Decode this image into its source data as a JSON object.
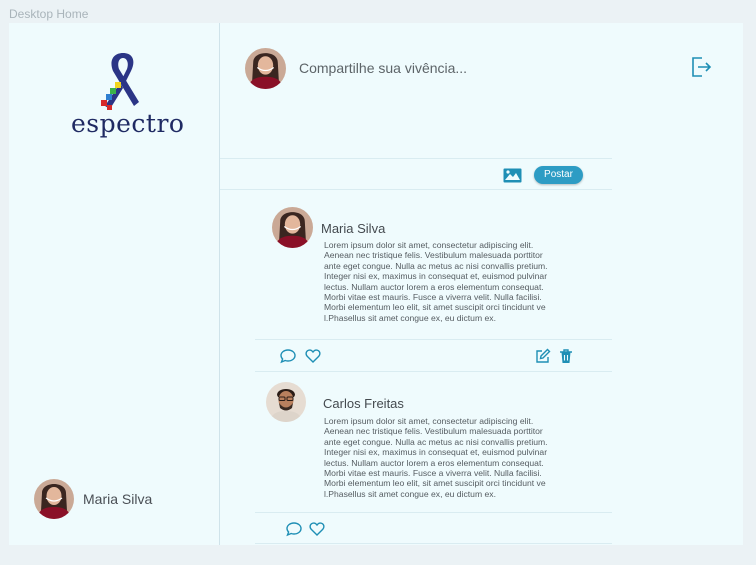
{
  "frame_label": "Desktop Home",
  "brand": {
    "name": "espectro"
  },
  "composer": {
    "placeholder": "Compartilhe sua vivência...",
    "post_label": "Postar"
  },
  "sidebar": {
    "user_name": "Maria Silva"
  },
  "posts": [
    {
      "author": "Maria Silva",
      "text": "Lorem ipsum dolor sit amet, consectetur adipiscing elit.\n Aenean nec tristique felis. Vestibulum malesuada porttitor\nante eget congue. Nulla ac metus ac nisi convallis pretium.\n Integer nisi ex, maximus in consequat et, euismod pulvinar\n lectus. Nullam auctor lorem a eros elementum consequat.\nMorbi vitae est mauris. Fusce a viverra velit. Nulla facilisi.\nMorbi elementum leo elit, sit amet suscipit orci tincidunt ve\nl.Phasellus sit amet congue ex, eu dictum ex."
    },
    {
      "author": "Carlos Freitas",
      "text": "Lorem ipsum dolor sit amet, consectetur adipiscing elit.\n Aenean nec tristique felis. Vestibulum malesuada porttitor\nante eget congue. Nulla ac metus ac nisi convallis pretium.\n Integer nisi ex, maximus in consequat et, euismod pulvinar\n lectus. Nullam auctor lorem a eros elementum consequat.\nMorbi vitae est mauris. Fusce a viverra velit. Nulla facilisi.\nMorbi elementum leo elit, sit amet suscipit orci tincidunt ve\nl.Phasellus sit amet congue ex, eu dictum ex."
    }
  ],
  "colors": {
    "accent": "#2d9cc4",
    "icon": "#1f8fb5",
    "brand": "#1f2a63",
    "background": "#effbfd"
  },
  "icons": [
    "logout-icon",
    "image-icon",
    "comment-icon",
    "heart-icon",
    "edit-icon",
    "trash-icon"
  ]
}
